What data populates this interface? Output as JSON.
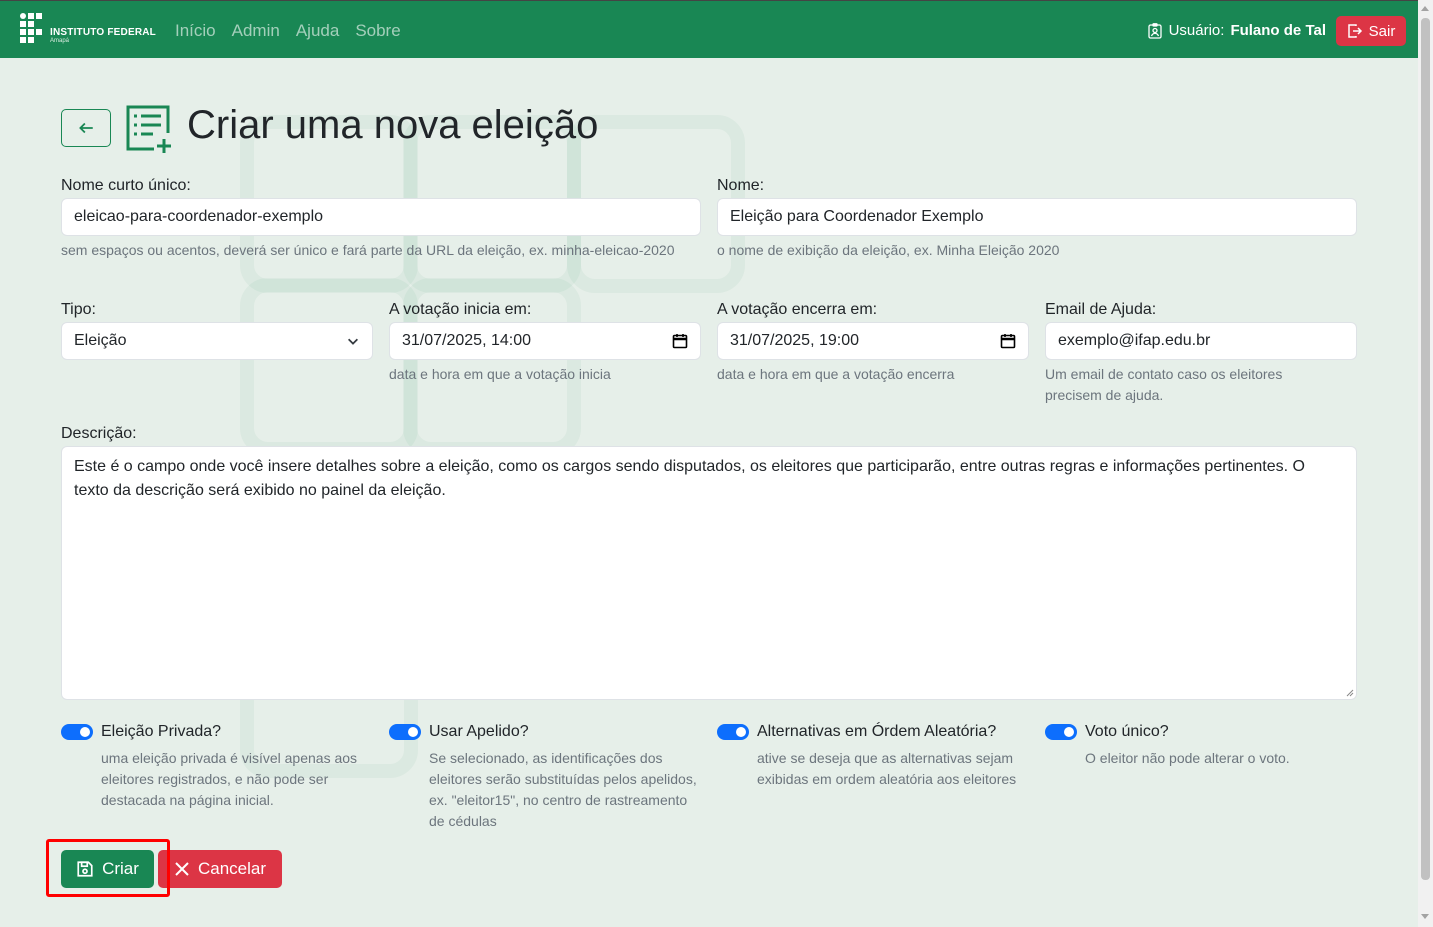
{
  "brand": {
    "name": "INSTITUTO FEDERAL",
    "campus": "Amapá"
  },
  "nav": {
    "items": [
      "Início",
      "Admin",
      "Ajuda",
      "Sobre"
    ]
  },
  "user": {
    "prefix": "Usuário:",
    "name": "Fulano de Tal",
    "logout_label": "Sair"
  },
  "page": {
    "title": "Criar uma nova eleição"
  },
  "form": {
    "short_name": {
      "label": "Nome curto único:",
      "value": "eleicao-para-coordenador-exemplo",
      "help": "sem espaços ou acentos, deverá ser único e fará parte da URL da eleição, ex. minha-eleicao-2020"
    },
    "name": {
      "label": "Nome:",
      "value": "Eleição para Coordenador Exemplo",
      "help": "o nome de exibição da eleição, ex. Minha Eleição 2020"
    },
    "type": {
      "label": "Tipo:",
      "value": "Eleição"
    },
    "start": {
      "label": "A votação inicia em:",
      "value": "31/07/2025, 14:00",
      "help": "data e hora em que a votação inicia"
    },
    "end": {
      "label": "A votação encerra em:",
      "value": "31/07/2025, 19:00",
      "help": "data e hora em que a votação encerra"
    },
    "email": {
      "label": "Email de Ajuda:",
      "value": "exemplo@ifap.edu.br",
      "help": "Um email de contato caso os eleitores precisem de ajuda."
    },
    "description": {
      "label": "Descrição:",
      "value": "Este é o campo onde você insere detalhes sobre a eleição, como os cargos sendo disputados, os eleitores que participarão, entre outras regras e informações pertinentes. O texto da descrição será exibido no painel da eleição."
    },
    "switches": [
      {
        "label": "Eleição Privada?",
        "checked": true,
        "help": "uma eleição privada é visível apenas aos eleitores registrados, e não pode ser destacada na página inicial."
      },
      {
        "label": "Usar Apelido?",
        "checked": true,
        "help": "Se selecionado, as identificações dos eleitores serão substituídas pelos apelidos, ex. \"eleitor15\", no centro de rastreamento de cédulas"
      },
      {
        "label": "Alternativas em Órdem Aleatória?",
        "checked": true,
        "help": "ative se deseja que as alternativas sejam exibidas em ordem aleatória aos eleitores"
      },
      {
        "label": "Voto único?",
        "checked": true,
        "help": "O eleitor não pode alterar o voto."
      }
    ],
    "submit_label": "Criar",
    "cancel_label": "Cancelar"
  },
  "colors": {
    "primary": "#198754",
    "danger": "#dc3545",
    "switch": "#0d6efd",
    "highlight": "#ff0000"
  }
}
